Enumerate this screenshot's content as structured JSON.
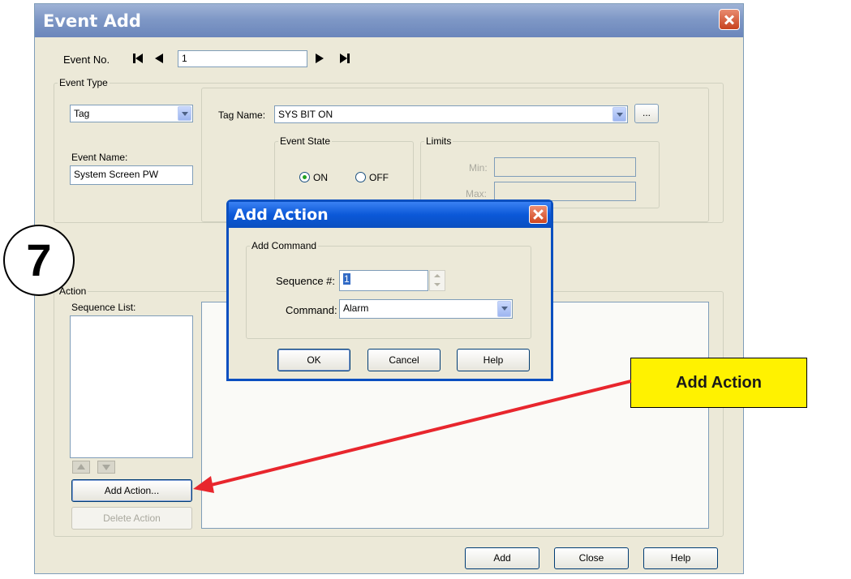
{
  "event_add": {
    "title": "Event Add",
    "event_no_label": "Event No.",
    "event_no_value": "1",
    "event_type_legend": "Event Type",
    "type_value": "Tag",
    "event_name_label": "Event Name:",
    "event_name_value": "System Screen PW",
    "tag_name_label": "Tag Name:",
    "tag_name_value": "SYS BIT ON",
    "browse_label": "...",
    "event_state_legend": "Event State",
    "on_label": "ON",
    "off_label": "OFF",
    "limits_legend": "Limits",
    "min_label": "Min:",
    "max_label": "Max:",
    "action_legend": "Action",
    "sequence_list_label": "Sequence List:",
    "add_action_button": "Add Action...",
    "delete_action_button": "Delete Action",
    "add_button": "Add",
    "close_button": "Close",
    "help_button": "Help"
  },
  "add_action_dialog": {
    "title": "Add Action",
    "group_legend": "Add Command",
    "sequence_label": "Sequence #:",
    "sequence_value": "1",
    "command_label": "Command:",
    "command_value": "Alarm",
    "ok_button": "OK",
    "cancel_button": "Cancel",
    "help_button": "Help"
  },
  "annotation": {
    "step_number": "7",
    "callout_text": "Add Action",
    "callout_color": "#fff200",
    "arrow_color": "#e8262d"
  },
  "icons": [
    "close-icon",
    "first-record-icon",
    "prev-record-icon",
    "next-record-icon",
    "last-record-icon",
    "dropdown-arrow-icon",
    "move-up-icon",
    "move-down-icon",
    "spin-up-icon",
    "spin-down-icon"
  ]
}
